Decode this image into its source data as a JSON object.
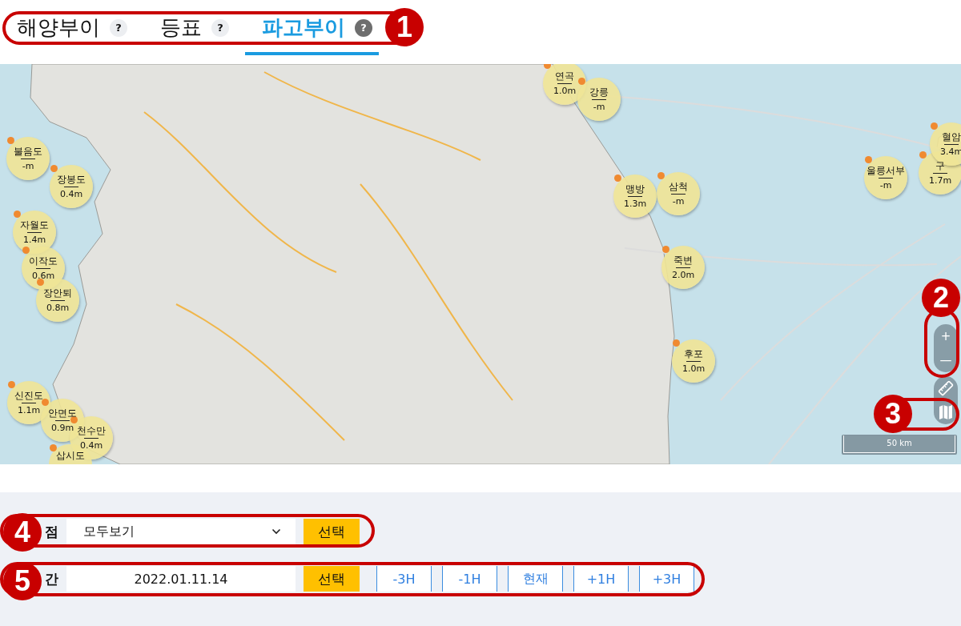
{
  "tabs": [
    {
      "label": "해양부이",
      "help": "?",
      "selected": false
    },
    {
      "label": "등표",
      "help": "?",
      "selected": false
    },
    {
      "label": "파고부이",
      "help": "?",
      "selected": true
    }
  ],
  "map": {
    "buoys": [
      {
        "name": "불음도",
        "value": "-m"
      },
      {
        "name": "장봉도",
        "value": "0.4m"
      },
      {
        "name": "자월도",
        "value": "1.4m"
      },
      {
        "name": "이작도",
        "value": "0.6m"
      },
      {
        "name": "장안퇴",
        "value": "0.8m"
      },
      {
        "name": "신진도",
        "value": "1.1m"
      },
      {
        "name": "안면도",
        "value": "0.9m"
      },
      {
        "name": "천수만",
        "value": "0.4m"
      },
      {
        "name": "삽시도"
      },
      {
        "name": "연곡",
        "value": "1.0m"
      },
      {
        "name": "강릉",
        "value": "-m"
      },
      {
        "name": "맹방",
        "value": "1.3m"
      },
      {
        "name": "삼척",
        "value": "-m"
      },
      {
        "name": "울릉서부",
        "value": "-m"
      },
      {
        "name": "구",
        "value": "1.7m"
      },
      {
        "name": "혈암",
        "value": "3.4m"
      },
      {
        "name": "죽변",
        "value": "2.0m"
      },
      {
        "name": "후포",
        "value": "1.0m"
      }
    ],
    "zoom": {
      "zoom_in": "+",
      "zoom_out": "—"
    },
    "scale": "50 km"
  },
  "filters": [
    {
      "kind": "select",
      "label": "점",
      "value": "모두보기",
      "button": "선택"
    },
    {
      "kind": "field",
      "label": "간",
      "value": "2022.01.11.14",
      "button": "선택",
      "steps": [
        "-3H",
        "-1H",
        "현재",
        "+1H",
        "+3H"
      ]
    }
  ],
  "callouts": [
    {
      "label": "1"
    },
    {
      "label": "2"
    },
    {
      "label": "3"
    },
    {
      "label": "4"
    },
    {
      "label": "5"
    }
  ]
}
